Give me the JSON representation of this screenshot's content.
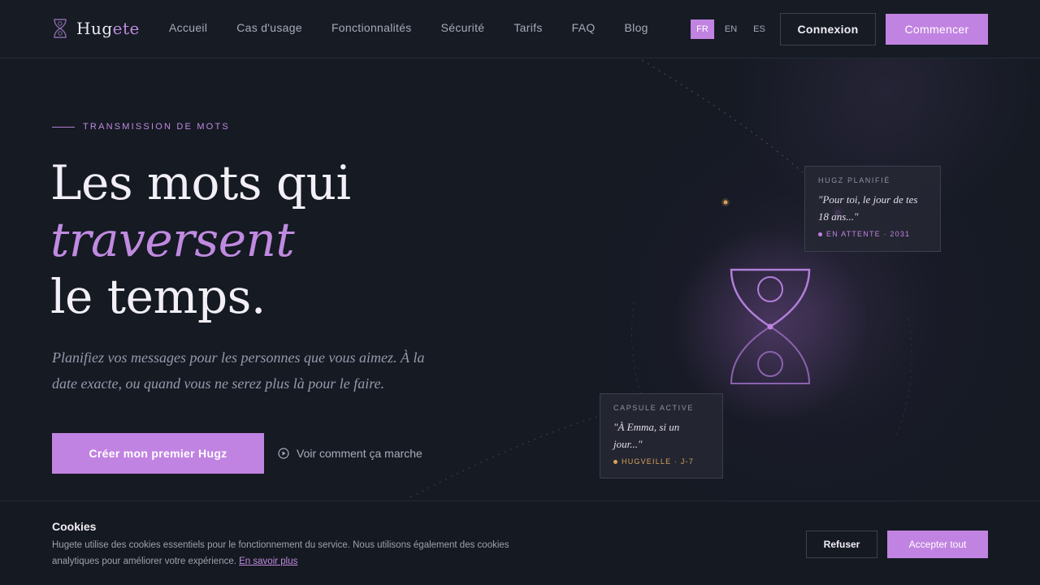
{
  "brand": {
    "name_main": "Hug",
    "name_accent": "ete",
    "accent_color": "#c183e1"
  },
  "nav": {
    "items": [
      {
        "label": "Accueil"
      },
      {
        "label": "Cas d'usage"
      },
      {
        "label": "Fonctionnalités"
      },
      {
        "label": "Sécurité"
      },
      {
        "label": "Tarifs"
      },
      {
        "label": "FAQ"
      },
      {
        "label": "Blog"
      }
    ]
  },
  "languages": {
    "options": [
      "FR",
      "EN",
      "ES"
    ],
    "selected": "FR"
  },
  "header": {
    "login_label": "Connexion",
    "start_label": "Commencer"
  },
  "hero": {
    "eyebrow": "TRANSMISSION DE MOTS",
    "title_line1": "Les mots qui",
    "title_line2": "traversent",
    "title_line3": "le temps.",
    "subtitle": "Planifiez vos messages pour les personnes que vous aimez. À la date exacte, ou quand vous ne serez plus là pour le faire.",
    "cta_label": "Créer mon premier Hugz",
    "secondary_label": "Voir comment ça marche"
  },
  "cards": {
    "scheduled": {
      "label": "HUGZ PLANIFIÉ",
      "quote": "\"Pour toi, le jour de tes 18 ans...\"",
      "status": "EN ATTENTE · 2031",
      "status_color": "#c183e1"
    },
    "capsule": {
      "label": "CAPSULE ACTIVE",
      "quote": "\"À Emma, si un jour...\"",
      "status": "HUGVEILLE · J-7",
      "status_color": "#d9a35b"
    }
  },
  "cookies": {
    "title": "Cookies",
    "body": "Hugete utilise des cookies essentiels pour le fonctionnement du service. Nous utilisons également des cookies analytiques pour améliorer votre expérience.",
    "link_label": "En savoir plus",
    "refuse_label": "Refuser",
    "accept_label": "Accepter tout"
  }
}
